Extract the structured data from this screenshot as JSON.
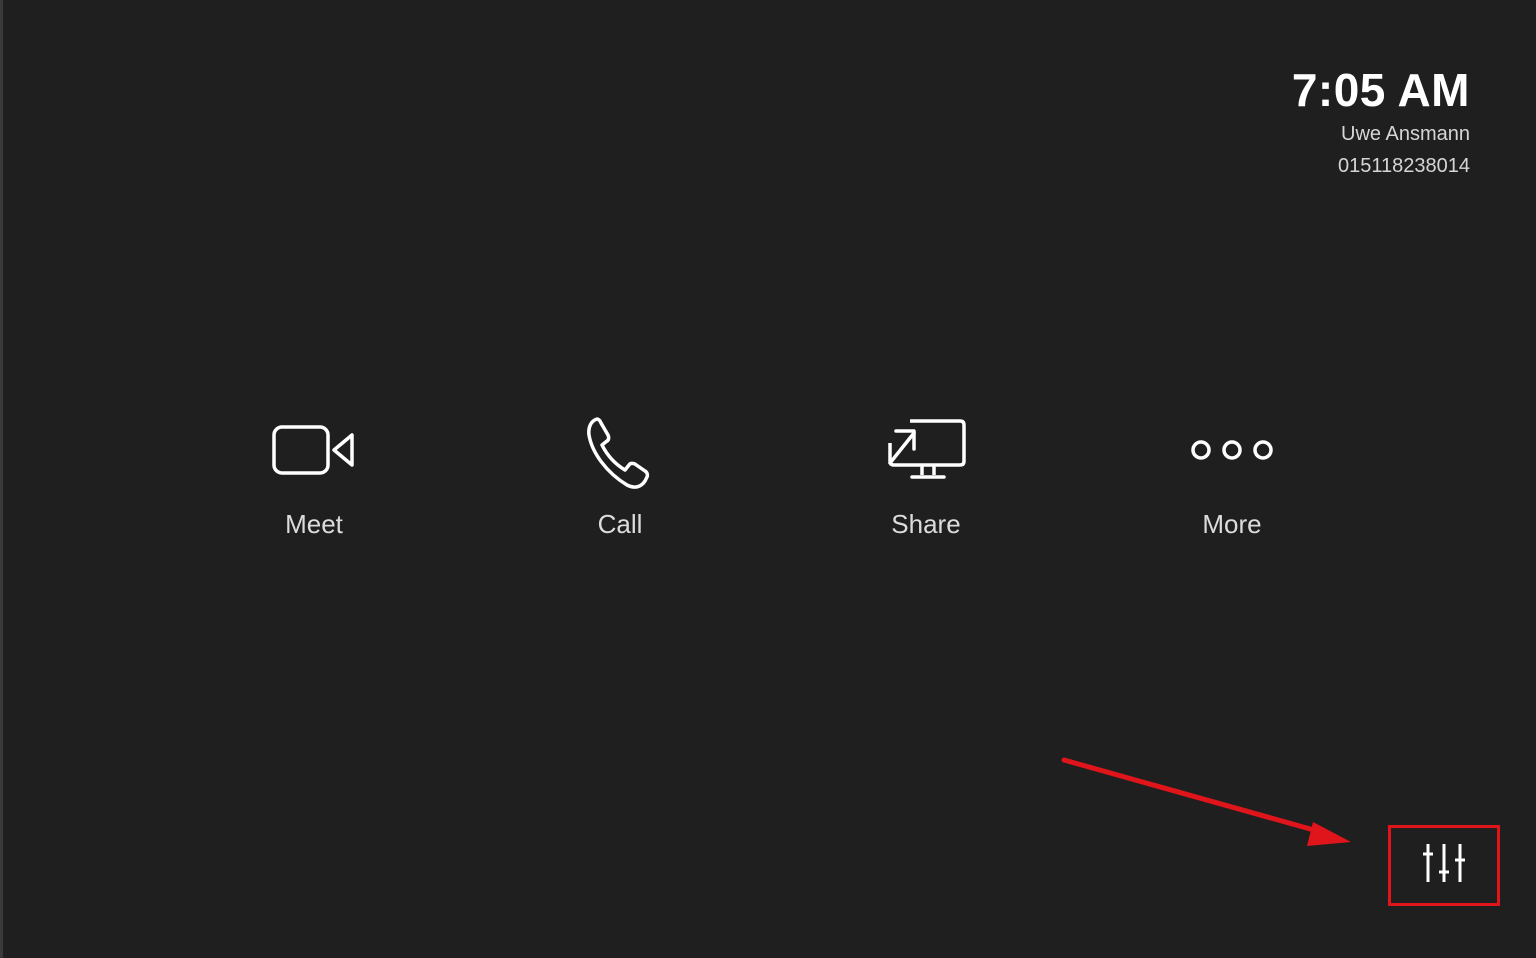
{
  "status": {
    "time": "7:05 AM",
    "user_name": "Uwe Ansmann",
    "phone_number": "015118238014"
  },
  "actions": [
    {
      "label": "Meet",
      "icon": "video-camera-icon"
    },
    {
      "label": "Call",
      "icon": "phone-icon"
    },
    {
      "label": "Share",
      "icon": "screen-share-icon"
    },
    {
      "label": "More",
      "icon": "more-dots-icon"
    }
  ],
  "settings": {
    "icon": "sliders-icon"
  },
  "colors": {
    "background": "#1f1f1f",
    "highlight": "#e0151b",
    "text": "#ffffff"
  }
}
